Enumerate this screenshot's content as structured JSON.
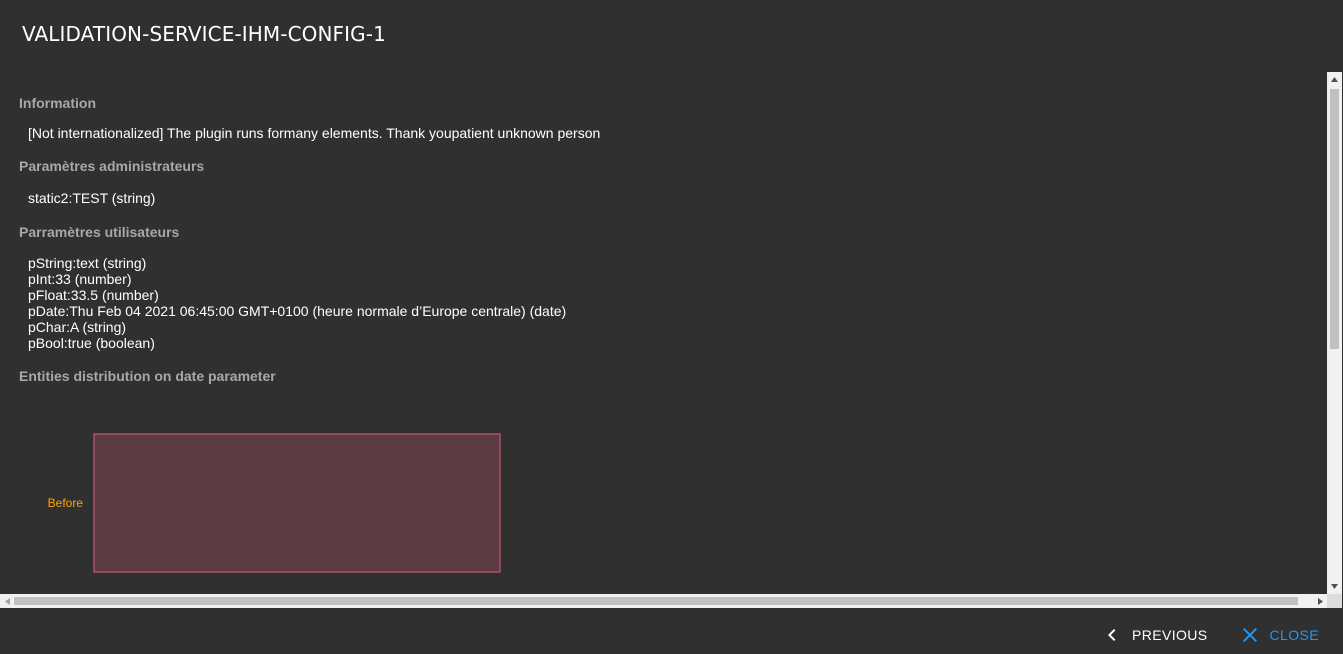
{
  "dialog": {
    "title": "VALIDATION-SERVICE-IHM-CONFIG-1"
  },
  "sections": {
    "information": {
      "title": "Information",
      "text": "[Not internationalized] The plugin runs formany elements. Thank youpatient unknown person"
    },
    "admin_params": {
      "title": "Paramètres administrateurs",
      "items": [
        "static2:TEST (string)"
      ]
    },
    "user_params": {
      "title": "Parramètres utilisateurs",
      "items": [
        "pString:text (string)",
        "pInt:33 (number)",
        "pFloat:33.5 (number)",
        "pDate:Thu Feb 04 2021 06:45:00 GMT+0100 (heure normale d’Europe centrale) (date)",
        "pChar:A (string)",
        "pBool:true (boolean)"
      ]
    },
    "distribution": {
      "title": "Entities distribution on date parameter"
    }
  },
  "chart_data": {
    "type": "bar",
    "categories": [
      "Before"
    ],
    "values": [
      1
    ],
    "xlim": [
      0,
      1
    ],
    "colors": {
      "bar_fill": "#5c3a41",
      "bar_stroke": "#e0607a",
      "category_label": "#ffa500"
    }
  },
  "actions": {
    "previous_label": "PREVIOUS",
    "close_label": "CLOSE"
  },
  "icons": {
    "previous": "chevron-left-icon",
    "close": "close-icon"
  },
  "colors": {
    "background": "#303030",
    "section_title": "#a8a8a8",
    "accent": "#2196f3"
  }
}
